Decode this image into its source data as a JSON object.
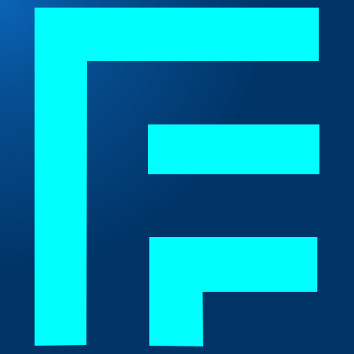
{
  "logo": {
    "icon": "stylized-f-logo-icon",
    "foreground_color": "#00ffff",
    "background_color": "#003366",
    "highlight_color": "#0a64b8"
  }
}
